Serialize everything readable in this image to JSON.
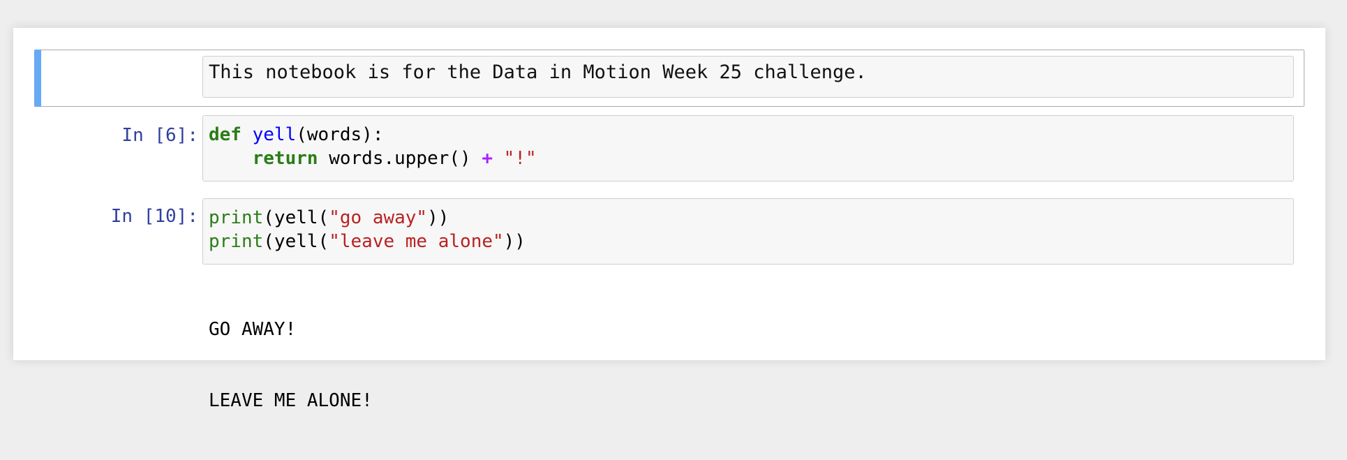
{
  "cells": [
    {
      "type": "markdown",
      "text": "This notebook is for the Data in Motion Week 25 challenge."
    },
    {
      "type": "code",
      "prompt": "In [6]:",
      "lines": [
        [
          {
            "t": "def",
            "c": "kw"
          },
          {
            "t": " ",
            "c": ""
          },
          {
            "t": "yell",
            "c": "fn-def"
          },
          {
            "t": "(words):",
            "c": ""
          }
        ],
        [
          {
            "t": "    ",
            "c": ""
          },
          {
            "t": "return",
            "c": "kw"
          },
          {
            "t": " words.upper() ",
            "c": ""
          },
          {
            "t": "+",
            "c": "op"
          },
          {
            "t": " ",
            "c": ""
          },
          {
            "t": "\"!\"",
            "c": "str"
          }
        ]
      ]
    },
    {
      "type": "code",
      "prompt": "In [10]:",
      "lines": [
        [
          {
            "t": "print",
            "c": "builtin"
          },
          {
            "t": "(yell(",
            "c": ""
          },
          {
            "t": "\"go away\"",
            "c": "str"
          },
          {
            "t": "))",
            "c": ""
          }
        ],
        [
          {
            "t": "print",
            "c": "builtin"
          },
          {
            "t": "(yell(",
            "c": ""
          },
          {
            "t": "\"leave me alone\"",
            "c": "str"
          },
          {
            "t": "))",
            "c": ""
          }
        ]
      ],
      "output": [
        "GO AWAY!",
        "LEAVE ME ALONE!"
      ]
    }
  ],
  "colors": {
    "selected_bar": "#66a9f5",
    "prompt": "#303f9f",
    "keyword": "#2a7d17",
    "function_name": "#0000ff",
    "string": "#ba2121",
    "operator": "#aa22ff"
  }
}
